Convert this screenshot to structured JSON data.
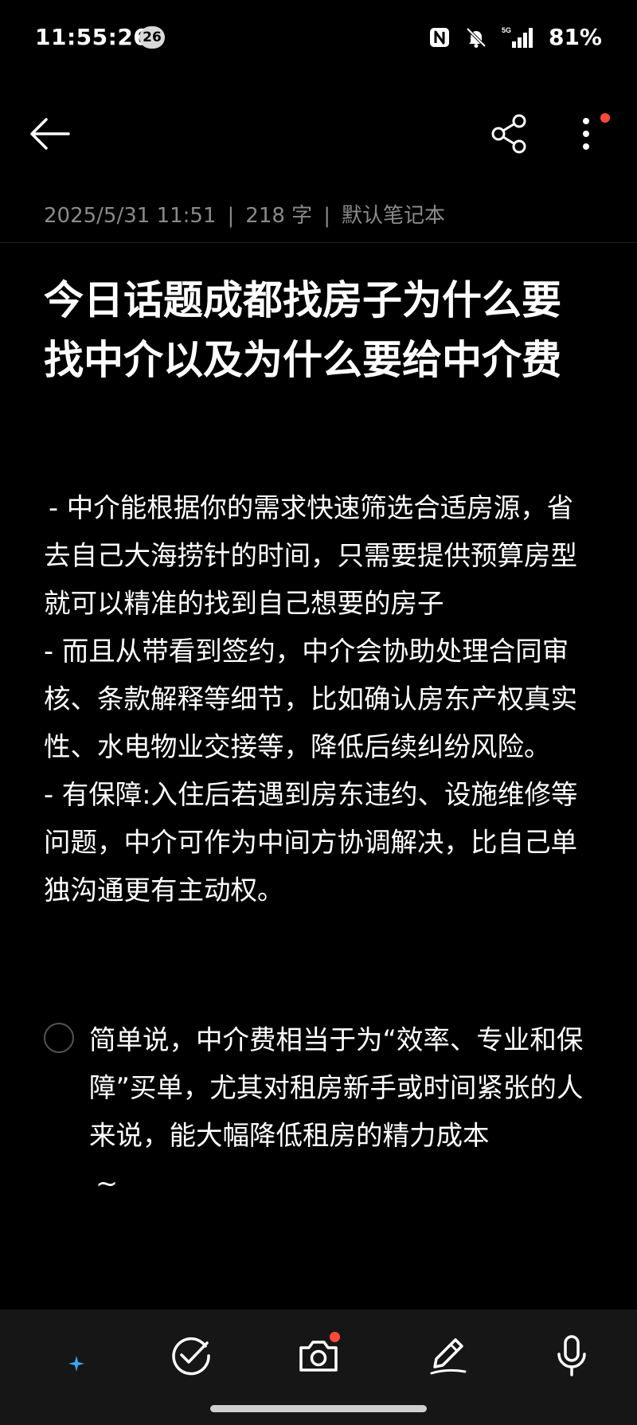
{
  "status_bar": {
    "time": "11:55:26",
    "notification_count": "26",
    "battery": "81%",
    "network": "5G",
    "icons": [
      "nfc-icon",
      "mute-bell-icon",
      "5g-signal-icon"
    ]
  },
  "toolbar": {
    "icons": [
      "back-arrow-icon",
      "share-icon",
      "more-vertical-icon"
    ],
    "accent": "#ff4a3b"
  },
  "meta": {
    "datetime": "2025/5/31 11:51",
    "separator": "|",
    "word_count": "218 字",
    "notebook": "默认笔记本"
  },
  "note": {
    "title": "今日话题成都找房子为什么要找中介以及为什么要给中介费",
    "paragraphs": [
      " - 中介能根据你的需求快速筛选合适房源，省去自己大海捞针的时间，只需要提供预算房型 就可以精准的找到自己想要的房子",
      "- 而且从带看到签约，中介会协助处理合同审核、条款解释等细节，比如确认房东产权真实性、水电物业交接等，降低后续纠纷风险。",
      "- 有保障:入住后若遇到房东违约、设施维修等问题，中介可作为中间方协调解决，比自己单独沟通更有主动权。"
    ],
    "checklist_item": {
      "checked": false,
      "text": "简单说，中介费相当于为“效率、专业和保障”买单，尤其对租房新手或时间紧张的人来说，能大幅降低租房的精力成本",
      "tail": "~"
    }
  },
  "bottom_bar": {
    "icons": [
      "ai-text-icon",
      "checklist-icon",
      "camera-icon",
      "handwriting-pen-icon",
      "microphone-icon"
    ]
  }
}
